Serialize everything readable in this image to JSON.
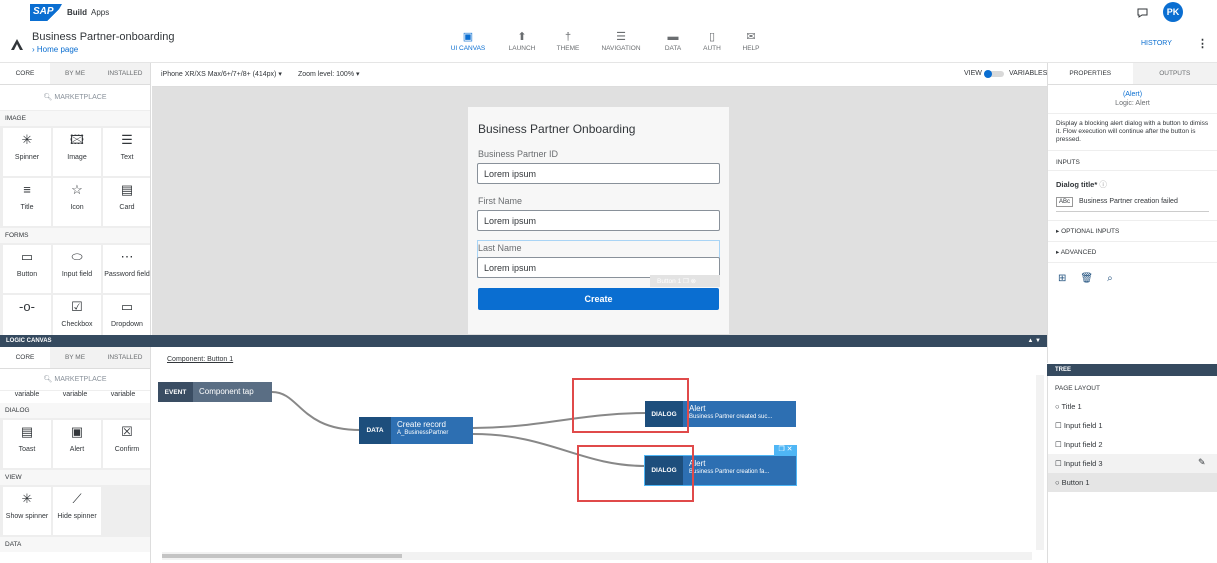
{
  "topbar": {
    "logo": "SAP",
    "build": "Build",
    "apps": "Apps",
    "avatar": "PK"
  },
  "header": {
    "title": "Business Partner-onboarding",
    "home": "Home page",
    "history": "HISTORY"
  },
  "nav": [
    {
      "label": "UI CANVAS",
      "icon": "ui-canvas-icon"
    },
    {
      "label": "LAUNCH",
      "icon": "launch-icon"
    },
    {
      "label": "THEME",
      "icon": "theme-icon"
    },
    {
      "label": "NAVIGATION",
      "icon": "navigation-icon"
    },
    {
      "label": "DATA",
      "icon": "data-icon"
    },
    {
      "label": "AUTH",
      "icon": "auth-icon"
    },
    {
      "label": "HELP",
      "icon": "help-icon"
    }
  ],
  "left": {
    "tabs": [
      "CORE",
      "BY ME",
      "INSTALLED"
    ],
    "search": "MARKETPLACE",
    "sections": {
      "image": "IMAGE",
      "forms": "FORMS"
    },
    "tiles": [
      "Spinner",
      "Image",
      "Text",
      "Title",
      "Icon",
      "Card",
      "Button",
      "Input field",
      "Password field",
      "",
      "Checkbox",
      "Dropdown"
    ]
  },
  "canvasbar": {
    "device": "iPhone XR/XS Max/6+/7+/8+ (414px)",
    "zoom_label": "Zoom level:",
    "zoom": "100%",
    "view": "VIEW",
    "variables": "VARIABLES"
  },
  "phone": {
    "title": "Business Partner Onboarding",
    "fields": [
      {
        "label": "Business Partner ID",
        "value": "Lorem ipsum"
      },
      {
        "label": "First Name",
        "value": "Lorem ipsum"
      },
      {
        "label": "Last Name",
        "value": "Lorem ipsum"
      }
    ],
    "button": "Create",
    "button_tag": "Button 1"
  },
  "right": {
    "tabs": [
      "PROPERTIES",
      "OUTPUTS"
    ],
    "alert": "(Alert)",
    "logic": "Logic: Alert",
    "desc": "Display a blocking alert dialog with a button to dimiss it. Flow execution will continue after the button is pressed.",
    "inputs": "INPUTS",
    "dialog_title": "Dialog title*",
    "dialog_value": "Business Partner creation failed",
    "optional": "OPTIONAL INPUTS",
    "advanced": "ADVANCED"
  },
  "logic": {
    "bar": "LOGIC CANVAS",
    "crumb": "Component: Button 1",
    "tabs": [
      "CORE",
      "BY ME",
      "INSTALLED"
    ],
    "search": "MARKETPLACE",
    "vars": [
      "variable",
      "variable",
      "variable"
    ],
    "dialog": "DIALOG",
    "dialog_tiles": [
      "Toast",
      "Alert",
      "Confirm"
    ],
    "view": "VIEW",
    "view_tiles": [
      "Show spinner",
      "Hide spinner"
    ],
    "data": "DATA"
  },
  "nodes": {
    "event_k": "EVENT",
    "event_v": "Component tap",
    "data_k": "DATA",
    "data_v": "Create record",
    "data_sub": "A_BusinessPartner",
    "d1_k": "DIALOG",
    "d1_v": "Alert",
    "d1_sub": "Business Partner created suc...",
    "d2_k": "DIALOG",
    "d2_v": "Alert",
    "d2_sub": "Business Partner creation fa..."
  },
  "tree": {
    "bar": "TREE",
    "layout": "PAGE LAYOUT",
    "items": [
      "Title 1",
      "Input field 1",
      "Input field 2",
      "Input field 3",
      "Button 1"
    ]
  }
}
